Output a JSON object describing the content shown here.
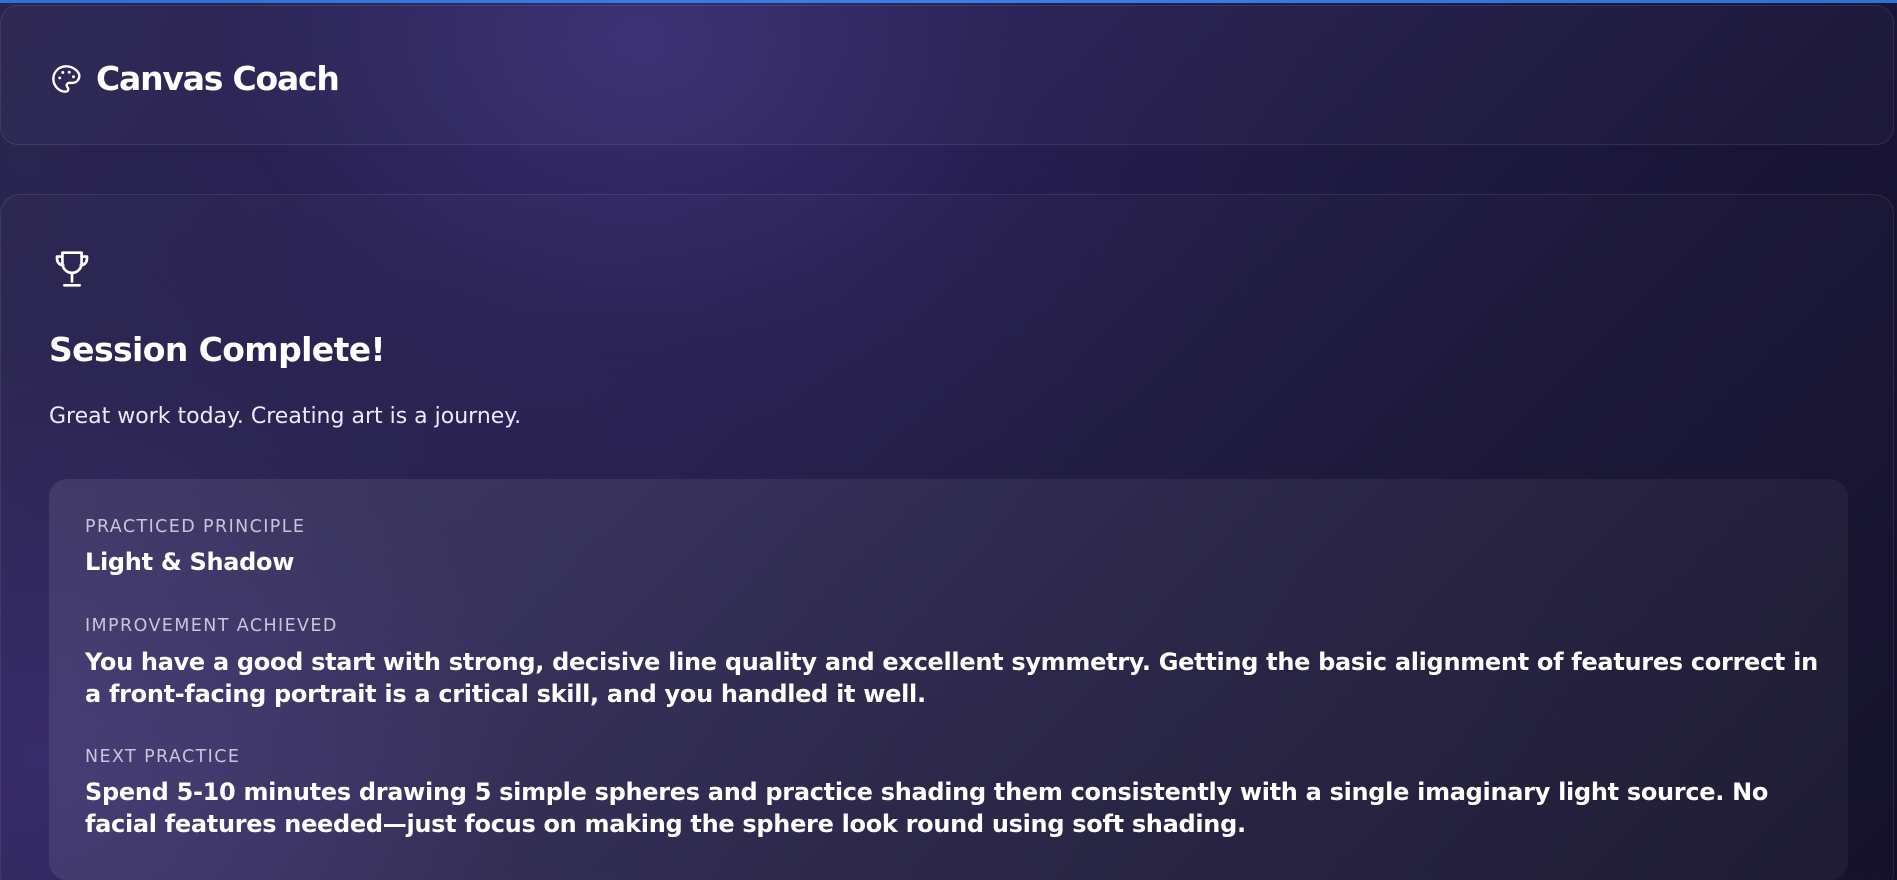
{
  "header": {
    "logo_icon": "palette-icon",
    "app_title": "Canvas Coach"
  },
  "session": {
    "icon": "trophy-icon",
    "title": "Session Complete!",
    "subtitle": "Great work today. Creating art is a journey."
  },
  "summary": {
    "practiced_principle": {
      "label": "PRACTICED PRINCIPLE",
      "value": "Light & Shadow"
    },
    "improvement_achieved": {
      "label": "IMPROVEMENT ACHIEVED",
      "value": "You have a good start with strong, decisive line quality and excellent symmetry. Getting the basic alignment of features correct in a front-facing portrait is a critical skill, and you handled it well."
    },
    "next_practice": {
      "label": "NEXT PRACTICE",
      "value": "Spend 5-10 minutes drawing 5 simple spheres and practice shading them consistently with a single imaginary light source. No facial features needed—just focus on making the sphere look round using soft shading."
    }
  },
  "colors": {
    "accent_bar": "#3b7fe6",
    "background_top": "#2a2550",
    "background_bottom": "#110e26"
  }
}
